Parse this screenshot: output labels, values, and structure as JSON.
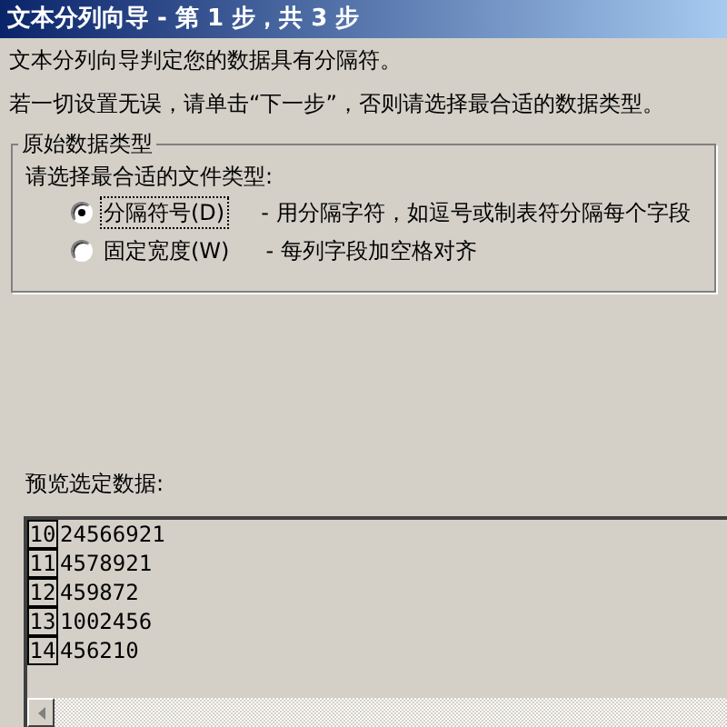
{
  "window": {
    "title": "文本分列向导 - 第 1 步，共 3 步"
  },
  "intro": [
    "文本分列向导判定您的数据具有分隔符。",
    "若一切设置无误，请单击“下一步”，否则请选择最合适的数据类型。"
  ],
  "data_type_group": {
    "title": "原始数据类型",
    "prompt": "请选择最合适的文件类型:",
    "options": [
      {
        "label": "分隔符号(D)",
        "description": "- 用分隔字符，如逗号或制表符分隔每个字段",
        "selected": true
      },
      {
        "label": "固定宽度(W)",
        "description": "- 每列字段加空格对齐",
        "selected": false
      }
    ]
  },
  "preview": {
    "label": "预览选定数据:",
    "rows": [
      {
        "number": "10",
        "value": "24566921"
      },
      {
        "number": "11",
        "value": "4578921"
      },
      {
        "number": "12",
        "value": "459872"
      },
      {
        "number": "13",
        "value": "1002456"
      },
      {
        "number": "14",
        "value": "456210"
      }
    ]
  }
}
